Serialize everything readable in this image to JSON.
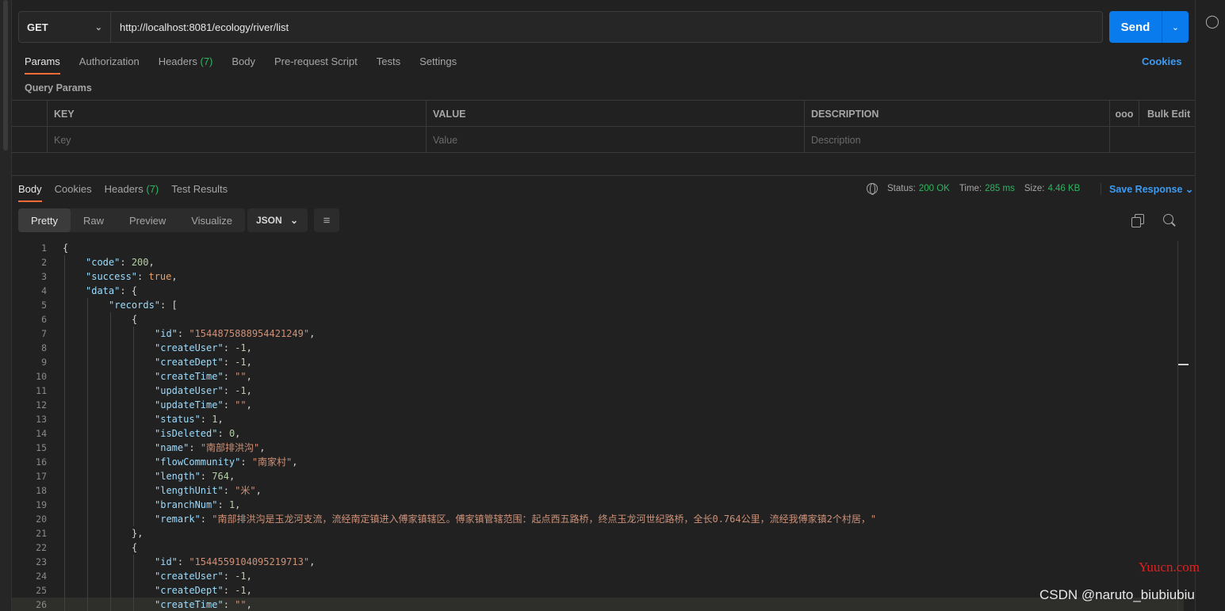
{
  "request": {
    "method": "GET",
    "url": "http://localhost:8081/ecology/river/list",
    "send_label": "Send"
  },
  "request_tabs": [
    {
      "label": "Params",
      "count": ""
    },
    {
      "label": "Authorization",
      "count": ""
    },
    {
      "label": "Headers",
      "count": "(7)"
    },
    {
      "label": "Body",
      "count": ""
    },
    {
      "label": "Pre-request Script",
      "count": ""
    },
    {
      "label": "Tests",
      "count": ""
    },
    {
      "label": "Settings",
      "count": ""
    }
  ],
  "cookies_link": "Cookies",
  "query_params": {
    "title": "Query Params",
    "headers": {
      "key": "KEY",
      "value": "VALUE",
      "description": "DESCRIPTION",
      "more": "ooo",
      "bulk_edit": "Bulk Edit"
    },
    "placeholders": {
      "key": "Key",
      "value": "Value",
      "description": "Description"
    }
  },
  "response_tabs": [
    {
      "label": "Body",
      "count": ""
    },
    {
      "label": "Cookies",
      "count": ""
    },
    {
      "label": "Headers",
      "count": "(7)"
    },
    {
      "label": "Test Results",
      "count": ""
    }
  ],
  "response_status": {
    "status_label": "Status:",
    "status_value": "200 OK",
    "time_label": "Time:",
    "time_value": "285 ms",
    "size_label": "Size:",
    "size_value": "4.46 KB",
    "save_response": "Save Response"
  },
  "format_tabs": [
    "Pretty",
    "Raw",
    "Preview",
    "Visualize"
  ],
  "format_select": "JSON",
  "code_lines": [
    {
      "n": "1",
      "indent": 0,
      "tokens": [
        [
          "p",
          "{"
        ]
      ]
    },
    {
      "n": "2",
      "indent": 1,
      "tokens": [
        [
          "k",
          "\"code\""
        ],
        [
          "p",
          ": "
        ],
        [
          "n",
          "200"
        ],
        [
          "p",
          ","
        ]
      ]
    },
    {
      "n": "3",
      "indent": 1,
      "tokens": [
        [
          "k",
          "\"success\""
        ],
        [
          "p",
          ": "
        ],
        [
          "b",
          "true"
        ],
        [
          "p",
          ","
        ]
      ]
    },
    {
      "n": "4",
      "indent": 1,
      "tokens": [
        [
          "k",
          "\"data\""
        ],
        [
          "p",
          ": {"
        ]
      ]
    },
    {
      "n": "5",
      "indent": 2,
      "tokens": [
        [
          "k",
          "\"records\""
        ],
        [
          "p",
          ": ["
        ]
      ]
    },
    {
      "n": "6",
      "indent": 3,
      "tokens": [
        [
          "p",
          "{"
        ]
      ]
    },
    {
      "n": "7",
      "indent": 4,
      "tokens": [
        [
          "k",
          "\"id\""
        ],
        [
          "p",
          ": "
        ],
        [
          "s",
          "\"1544875888954421249\""
        ],
        [
          "p",
          ","
        ]
      ]
    },
    {
      "n": "8",
      "indent": 4,
      "tokens": [
        [
          "k",
          "\"createUser\""
        ],
        [
          "p",
          ": "
        ],
        [
          "n",
          "-1"
        ],
        [
          "p",
          ","
        ]
      ]
    },
    {
      "n": "9",
      "indent": 4,
      "tokens": [
        [
          "k",
          "\"createDept\""
        ],
        [
          "p",
          ": "
        ],
        [
          "n",
          "-1"
        ],
        [
          "p",
          ","
        ]
      ]
    },
    {
      "n": "10",
      "indent": 4,
      "tokens": [
        [
          "k",
          "\"createTime\""
        ],
        [
          "p",
          ": "
        ],
        [
          "s",
          "\"\""
        ],
        [
          "p",
          ","
        ]
      ]
    },
    {
      "n": "11",
      "indent": 4,
      "tokens": [
        [
          "k",
          "\"updateUser\""
        ],
        [
          "p",
          ": "
        ],
        [
          "n",
          "-1"
        ],
        [
          "p",
          ","
        ]
      ]
    },
    {
      "n": "12",
      "indent": 4,
      "tokens": [
        [
          "k",
          "\"updateTime\""
        ],
        [
          "p",
          ": "
        ],
        [
          "s",
          "\"\""
        ],
        [
          "p",
          ","
        ]
      ]
    },
    {
      "n": "13",
      "indent": 4,
      "tokens": [
        [
          "k",
          "\"status\""
        ],
        [
          "p",
          ": "
        ],
        [
          "n",
          "1"
        ],
        [
          "p",
          ","
        ]
      ]
    },
    {
      "n": "14",
      "indent": 4,
      "tokens": [
        [
          "k",
          "\"isDeleted\""
        ],
        [
          "p",
          ": "
        ],
        [
          "n",
          "0"
        ],
        [
          "p",
          ","
        ]
      ]
    },
    {
      "n": "15",
      "indent": 4,
      "tokens": [
        [
          "k",
          "\"name\""
        ],
        [
          "p",
          ": "
        ],
        [
          "s",
          "\"南部排洪沟\""
        ],
        [
          "p",
          ","
        ]
      ]
    },
    {
      "n": "16",
      "indent": 4,
      "tokens": [
        [
          "k",
          "\"flowCommunity\""
        ],
        [
          "p",
          ": "
        ],
        [
          "s",
          "\"南家村\""
        ],
        [
          "p",
          ","
        ]
      ]
    },
    {
      "n": "17",
      "indent": 4,
      "tokens": [
        [
          "k",
          "\"length\""
        ],
        [
          "p",
          ": "
        ],
        [
          "n",
          "764"
        ],
        [
          "p",
          ","
        ]
      ]
    },
    {
      "n": "18",
      "indent": 4,
      "tokens": [
        [
          "k",
          "\"lengthUnit\""
        ],
        [
          "p",
          ": "
        ],
        [
          "s",
          "\"米\""
        ],
        [
          "p",
          ","
        ]
      ]
    },
    {
      "n": "19",
      "indent": 4,
      "tokens": [
        [
          "k",
          "\"branchNum\""
        ],
        [
          "p",
          ": "
        ],
        [
          "n",
          "1"
        ],
        [
          "p",
          ","
        ]
      ]
    },
    {
      "n": "20",
      "indent": 4,
      "tokens": [
        [
          "k",
          "\"remark\""
        ],
        [
          "p",
          ": "
        ],
        [
          "s",
          "\"南部排洪沟是玉龙河支流，流经南定镇进入傅家镇辖区。傅家镇管辖范围：起点西五路桥，终点玉龙河世纪路桥，全长0.764公里，流经我傅家镇2个村居，\""
        ]
      ]
    },
    {
      "n": "21",
      "indent": 3,
      "tokens": [
        [
          "p",
          "},"
        ]
      ]
    },
    {
      "n": "22",
      "indent": 3,
      "tokens": [
        [
          "p",
          "{"
        ]
      ]
    },
    {
      "n": "23",
      "indent": 4,
      "tokens": [
        [
          "k",
          "\"id\""
        ],
        [
          "p",
          ": "
        ],
        [
          "s",
          "\"1544559104095219713\""
        ],
        [
          "p",
          ","
        ]
      ]
    },
    {
      "n": "24",
      "indent": 4,
      "tokens": [
        [
          "k",
          "\"createUser\""
        ],
        [
          "p",
          ": "
        ],
        [
          "n",
          "-1"
        ],
        [
          "p",
          ","
        ]
      ]
    },
    {
      "n": "25",
      "indent": 4,
      "tokens": [
        [
          "k",
          "\"createDept\""
        ],
        [
          "p",
          ": "
        ],
        [
          "n",
          "-1"
        ],
        [
          "p",
          ","
        ]
      ]
    },
    {
      "n": "26",
      "indent": 4,
      "tokens": [
        [
          "k",
          "\"createTime\""
        ],
        [
          "p",
          ": "
        ],
        [
          "s",
          "\"\""
        ],
        [
          "p",
          ","
        ]
      ]
    }
  ],
  "watermarks": {
    "yuucn": "Yuucn.com",
    "csdn": "CSDN @naruto_biubiubiu"
  },
  "colors": {
    "accent_orange": "#ff6c37",
    "send_blue": "#097bed",
    "link_blue": "#3d9bf2",
    "status_green": "#2fb560"
  }
}
